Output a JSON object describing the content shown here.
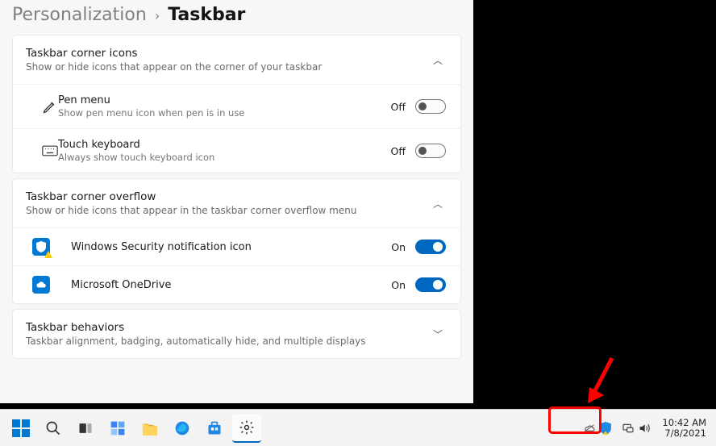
{
  "breadcrumb": {
    "parent": "Personalization",
    "current": "Taskbar"
  },
  "sections": {
    "cornerIcons": {
      "title": "Taskbar corner icons",
      "subtitle": "Show or hide icons that appear on the corner of your taskbar",
      "pen": {
        "title": "Pen menu",
        "subtitle": "Show pen menu icon when pen is in use",
        "state": "Off"
      },
      "touch": {
        "title": "Touch keyboard",
        "subtitle": "Always show touch keyboard icon",
        "state": "Off"
      }
    },
    "overflow": {
      "title": "Taskbar corner overflow",
      "subtitle": "Show or hide icons that appear in the taskbar corner overflow menu",
      "security": {
        "title": "Windows Security notification icon",
        "state": "On"
      },
      "onedrive": {
        "title": "Microsoft OneDrive",
        "state": "On"
      }
    },
    "behaviors": {
      "title": "Taskbar behaviors",
      "subtitle": "Taskbar alignment, badging, automatically hide, and multiple displays"
    }
  },
  "taskbar": {
    "clock": {
      "time": "10:42 AM",
      "date": "7/8/2021"
    }
  }
}
